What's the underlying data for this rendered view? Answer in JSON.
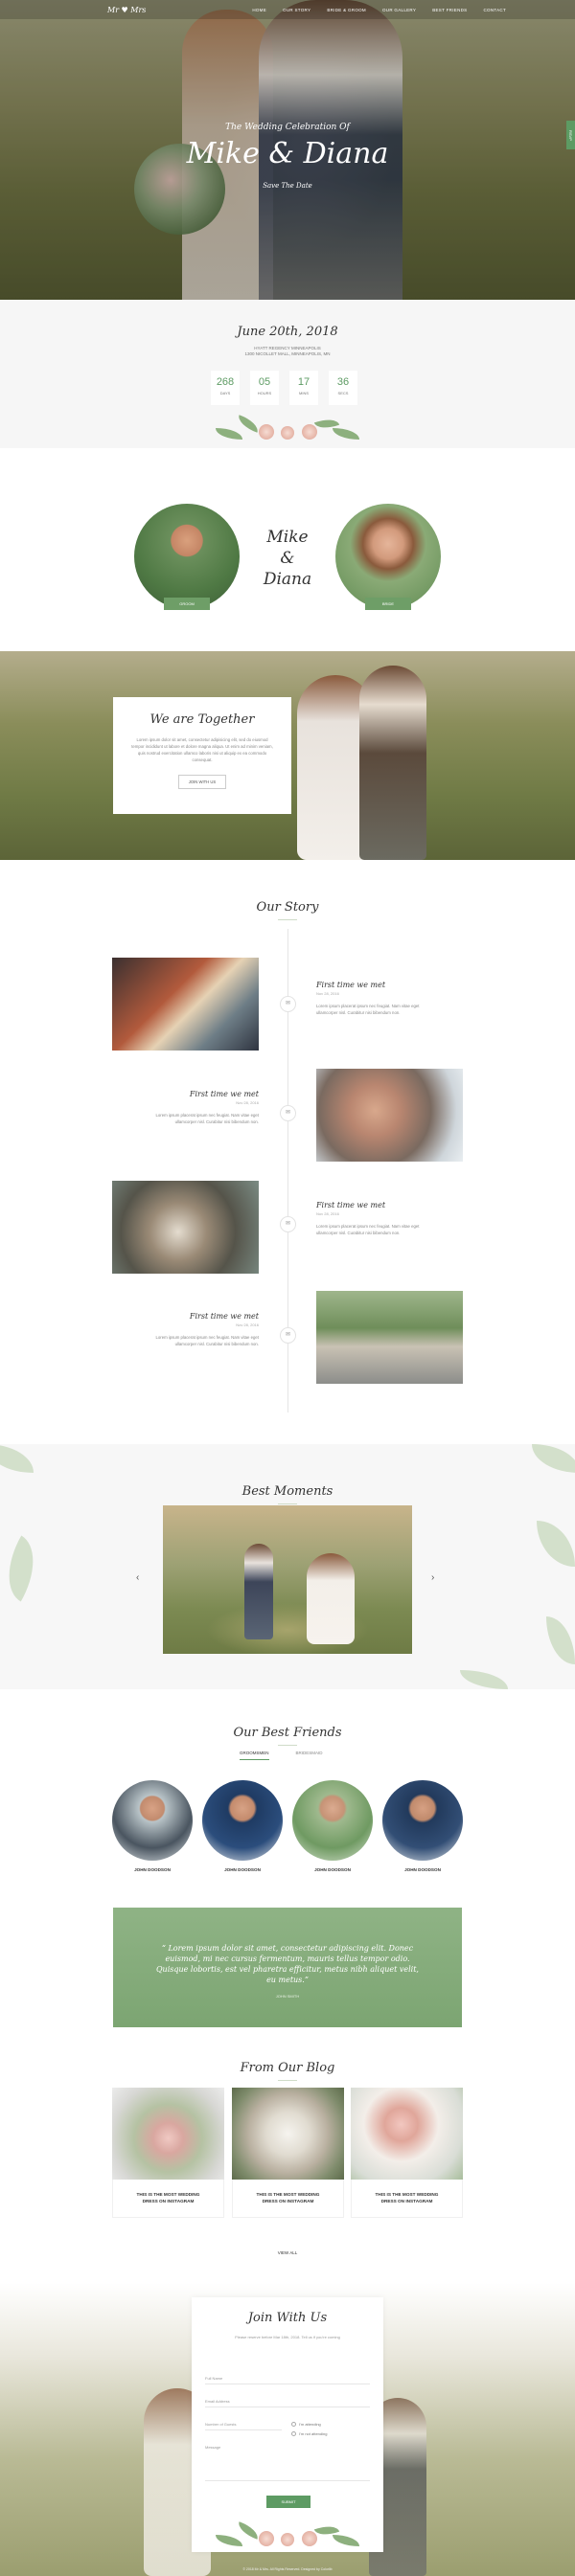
{
  "nav": {
    "logo": "Mr ♥ Mrs",
    "items": [
      "Home",
      "Our Story",
      "Bride & Groom",
      "Our Gallery",
      "Best Friends",
      "Contact"
    ],
    "side_tab": "RSVP"
  },
  "hero": {
    "subtitle": "The Wedding Celebration Of",
    "title": "Mike & Diana",
    "small": "Save The Date"
  },
  "countdown": {
    "date": "June 20th, 2018",
    "address_line1": "HYATT REGENCY MINNEAPOLIS",
    "address_line2": "1300 NICOLLET MALL, MINNEAPOLIS, MN",
    "units": [
      {
        "value": "268",
        "label": "DAYS"
      },
      {
        "value": "05",
        "label": "HOURS"
      },
      {
        "value": "17",
        "label": "MINS"
      },
      {
        "value": "36",
        "label": "SECS"
      }
    ]
  },
  "couple": {
    "groom_label": "GROOM",
    "bride_label": "BRIDE",
    "names_line1": "Mike",
    "names_line2": "&",
    "names_line3": "Diana"
  },
  "together": {
    "title": "We are Together",
    "text": "Lorem ipsum dolor sit amet, consectetur adipisicing elit, sed do eiusmod tempor incididunt ut labore et dolore magna aliqua. Ut enim ad minim veniam, quis nostrud exercitation ullamco laboris nisi ut aliquip ex ea commodo consequat.",
    "button": "JOIN WITH US"
  },
  "story": {
    "title": "Our Story",
    "events": [
      {
        "heading": "First time we met",
        "date": "Nov 28, 2016",
        "text": "Lorem ipsum placerat ipsum nec feugiat. Nam vitae eget ullamcorper nisl. Curabitur nisi bibendum non."
      },
      {
        "heading": "First time we met",
        "date": "Nov 28, 2016",
        "text": "Lorem ipsum placerat ipsum nec feugiat. Nam vitae eget ullamcorper nisl. Curabitur nisi bibendum non."
      },
      {
        "heading": "First time we met",
        "date": "Nov 28, 2016",
        "text": "Lorem ipsum placerat ipsum nec feugiat. Nam vitae eget ullamcorper nisl. Curabitur nisi bibendum non."
      },
      {
        "heading": "First time we met",
        "date": "Nov 28, 2016",
        "text": "Lorem ipsum placerat ipsum nec feugiat. Nam vitae eget ullamcorper nisl. Curabitur nisi bibendum non."
      }
    ]
  },
  "moments": {
    "title": "Best Moments",
    "prev": "‹",
    "next": "›"
  },
  "friends": {
    "title": "Our Best Friends",
    "tabs": [
      "GROOMSMEN",
      "BRIDESMAID"
    ],
    "people": [
      {
        "name": "JOHN DOODSON"
      },
      {
        "name": "JOHN DOODSON"
      },
      {
        "name": "JOHN DOODSON"
      },
      {
        "name": "JOHN DOODSON"
      }
    ],
    "quote": "“ Lorem ipsum dolor sit amet, consectetur adipiscing elit. Donec euismod, mi nec cursus fermentum, mauris tellus tempor odio. Quisque lobortis, est vel pharetra efficitur, metus nibh aliquet velit, eu metus.”",
    "quote_author": "JOHN SMITH"
  },
  "blog": {
    "title": "From Our Blog",
    "posts": [
      {
        "title_line1": "THIS IS THE MOST WEDDING",
        "title_line2": "DRESS ON INSTAGRAM"
      },
      {
        "title_line1": "THIS IS THE MOST WEDDING",
        "title_line2": "DRESS ON INSTAGRAM"
      },
      {
        "title_line1": "THIS IS THE MOST WEDDING",
        "title_line2": "DRESS ON INSTAGRAM"
      }
    ],
    "view_all": "VIEW ALL"
  },
  "rsvp": {
    "title": "Join With Us",
    "desc": "Please reserve before Mar 18th, 2018. Tell us if you're coming",
    "fields": {
      "name": "Full Name",
      "email": "Email Address",
      "guests": "Number of Guests",
      "message": "Message"
    },
    "radio_yes": "I'm attending",
    "radio_no": "I'm not attending",
    "submit": "SUBMIT"
  },
  "footer": "© 2018 Mr & Mrs. All Rights Reserved. Designed by Colorlib"
}
